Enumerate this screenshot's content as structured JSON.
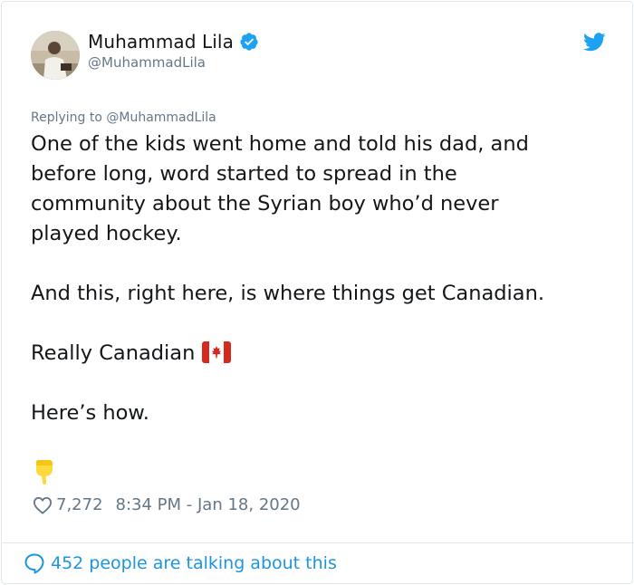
{
  "author": {
    "display_name": "Muhammad Lila",
    "handle": "@MuhammadLila"
  },
  "reply": {
    "text": "Replying to @MuhammadLila"
  },
  "tweet": {
    "line1": "One of the kids went home and told his dad, and",
    "line2": "before long, word started to spread in the",
    "line3": "community about the Syrian boy who’d never",
    "line4": "played hockey.",
    "line5": "And this, right here, is where things get Canadian.",
    "line6": "Really Canadian",
    "line7": "Here’s how."
  },
  "meta": {
    "likes": "7,272",
    "timestamp": "8:34 PM - Jan 18, 2020"
  },
  "footer": {
    "talking": "452 people are talking about this"
  },
  "icons": {
    "verified": "verified-badge-icon",
    "twitter": "twitter-bird-icon",
    "flag": "canada-flag-icon",
    "pointing": "pointing-down-icon",
    "heart": "heart-icon",
    "comment": "speech-bubble-icon"
  },
  "colors": {
    "link": "#1b95e0",
    "muted": "#657786",
    "text": "#14171a"
  }
}
